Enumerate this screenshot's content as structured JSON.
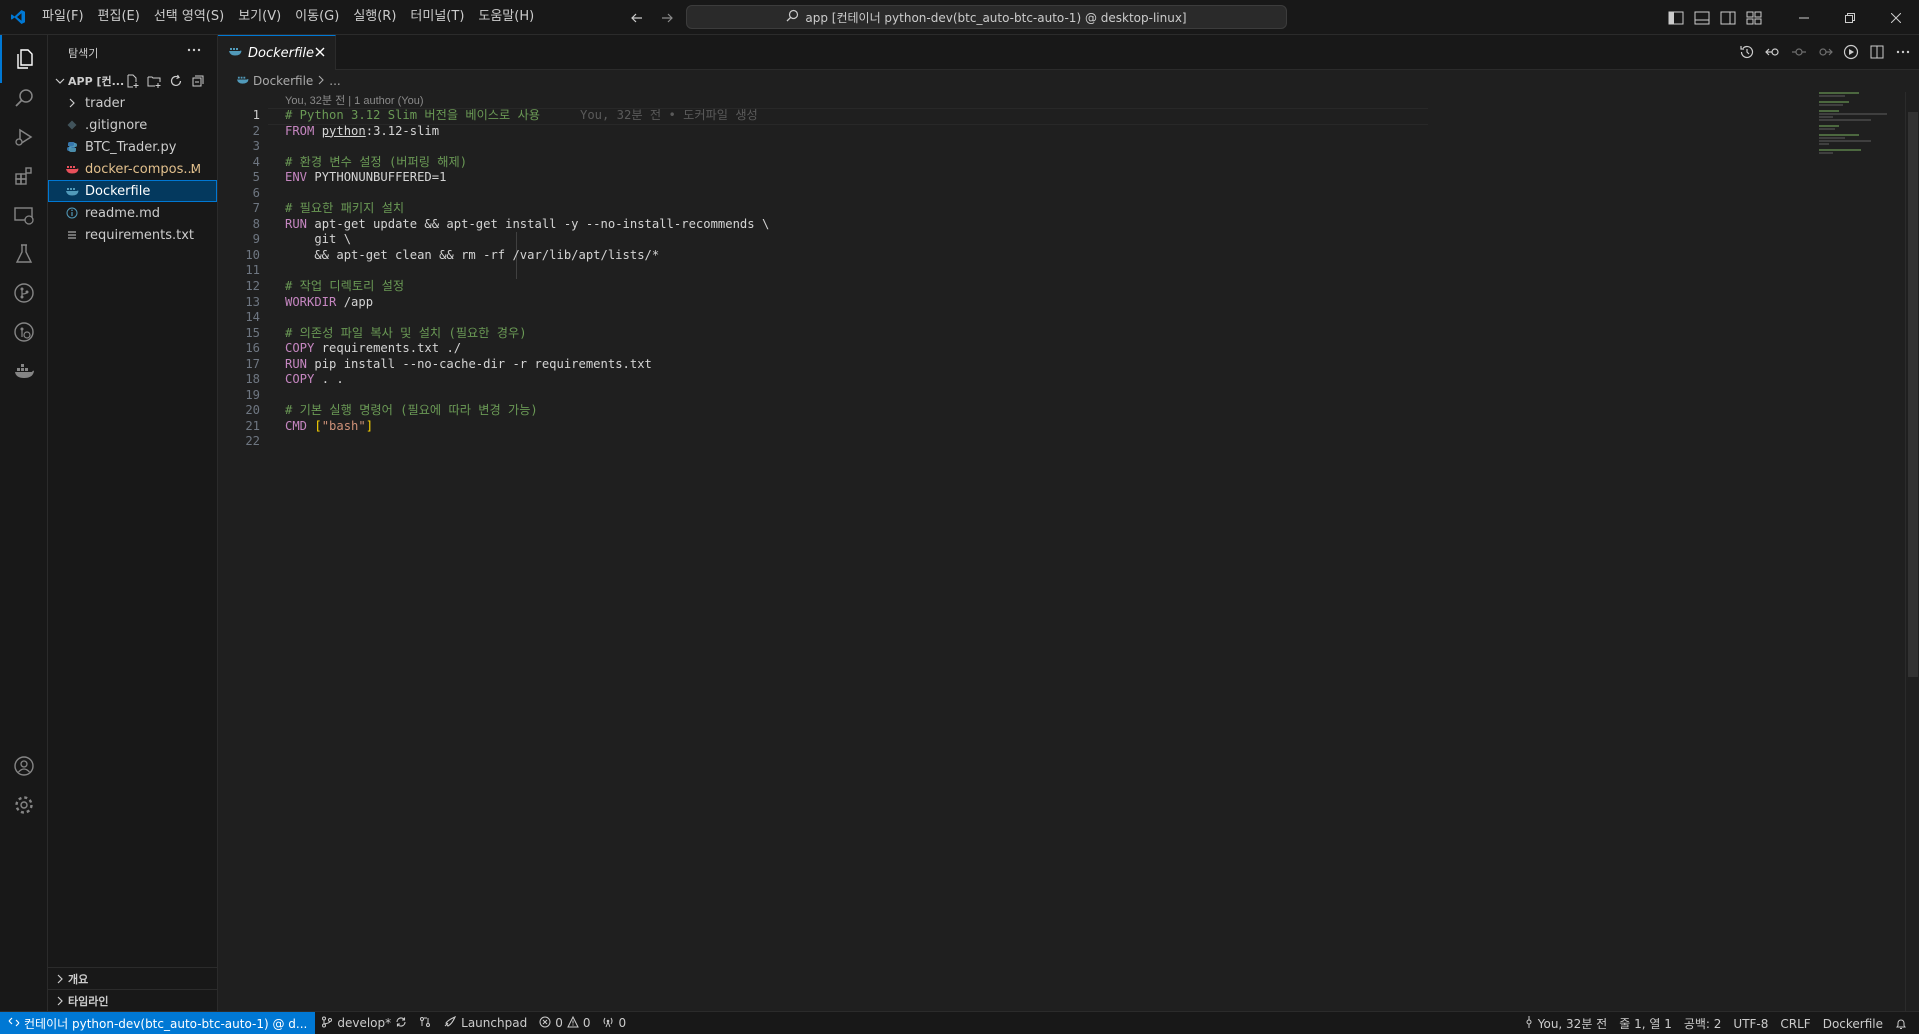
{
  "titlebar": {
    "menu": [
      "파일(F)",
      "편집(E)",
      "선택 영역(S)",
      "보기(V)",
      "이동(G)",
      "실행(R)",
      "터미널(T)",
      "도움말(H)"
    ],
    "command_center": "app [컨테이너 python-dev(btc_auto-btc-auto-1) @ desktop-linux]"
  },
  "sidebar": {
    "title": "탐색기",
    "folder": "APP [컨...",
    "items": [
      {
        "name": "trader",
        "type": "folder"
      },
      {
        "name": ".gitignore",
        "type": "git"
      },
      {
        "name": "BTC_Trader.py",
        "type": "python"
      },
      {
        "name": "docker-compos...",
        "type": "docker-compose",
        "badge": "M"
      },
      {
        "name": "Dockerfile",
        "type": "docker"
      },
      {
        "name": "readme.md",
        "type": "info"
      },
      {
        "name": "requirements.txt",
        "type": "text"
      }
    ],
    "bottom_sections": [
      "개요",
      "타임라인"
    ]
  },
  "editor": {
    "tab_label": "Dockerfile",
    "breadcrumb_file": "Dockerfile",
    "breadcrumb_rest": "...",
    "blame_header": "You, 32분 전 | 1 author (You)",
    "inline_blame": "You, 32분 전 • 도커파일 생성",
    "line_numbers": [
      "1",
      "2",
      "3",
      "4",
      "5",
      "6",
      "7",
      "8",
      "9",
      "10",
      "11",
      "12",
      "13",
      "14",
      "15",
      "16",
      "17",
      "18",
      "19",
      "20",
      "21",
      "22"
    ],
    "code": {
      "l1": "# Python 3.12 Slim 버전을 베이스로 사용",
      "l2_kw": "FROM",
      "l2_img": "python",
      "l2_tag": ":3.12-slim",
      "l4": "# 환경 변수 설정 (버퍼링 해제)",
      "l5_kw": "ENV",
      "l5_rest": "PYTHONUNBUFFERED=1",
      "l7": "# 필요한 패키지 설치",
      "l8_kw": "RUN",
      "l8_rest": "apt-get update && apt-get install -y --no-install-recommends \\",
      "l9": "    git \\",
      "l10": "    && apt-get clean && rm -rf /var/lib/apt/lists/*",
      "l12": "# 작업 디렉토리 설정",
      "l13_kw": "WORKDIR",
      "l13_rest": "/app",
      "l15": "# 의존성 파일 복사 및 설치 (필요한 경우)",
      "l16_kw": "COPY",
      "l16_rest": "requirements.txt ./",
      "l17_kw": "RUN",
      "l17_rest": "pip install --no-cache-dir -r requirements.txt",
      "l18_kw": "COPY",
      "l18_rest": ". .",
      "l20": "# 기본 실행 명령어 (필요에 따라 변경 가능)",
      "l21_kw": "CMD",
      "l21_open": "[",
      "l21_str": "\"bash\"",
      "l21_close": "]"
    }
  },
  "statusbar": {
    "remote": "컨테이너 python-dev(btc_auto-btc-auto-1) @ d...",
    "branch": "develop*",
    "launchpad": "Launchpad",
    "errors": "0",
    "warnings": "0",
    "ports": "0",
    "blame": "You, 32분 전",
    "position": "줄 1, 열 1",
    "spaces": "공백: 2",
    "encoding": "UTF-8",
    "eol": "CRLF",
    "language": "Dockerfile"
  },
  "colors": {
    "accent": "#0078d4",
    "comment": "#6a9955",
    "keyword": "#c586c0",
    "string": "#ce9178",
    "modified": "#e2c08d"
  }
}
